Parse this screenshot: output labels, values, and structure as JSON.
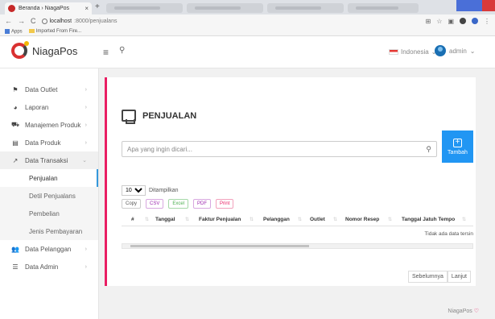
{
  "browser": {
    "tab_title": "Beranda › NiagaPos",
    "url_host": "localhost",
    "url_path": ":8000/penjualans",
    "bookmarks": [
      "Apps",
      "Imported From Fire..."
    ]
  },
  "header": {
    "brand": "NiagaPos",
    "language": "Indonesia",
    "user": "admin"
  },
  "sidebar": {
    "items": [
      {
        "label": "Data Outlet",
        "icon": "flag-icon"
      },
      {
        "label": "Laporan",
        "icon": "pie-chart-icon"
      },
      {
        "label": "Manajemen Produk",
        "icon": "cart-icon"
      },
      {
        "label": "Data Produk",
        "icon": "box-icon"
      },
      {
        "label": "Data Transaksi",
        "icon": "line-chart-icon",
        "open": true
      }
    ],
    "sub_items": [
      "Penjualan",
      "Detil Penjualans",
      "Pembelian",
      "Jenis Pembayaran"
    ],
    "items_after": [
      {
        "label": "Data Pelanggan",
        "icon": "users-icon"
      },
      {
        "label": "Data Admin",
        "icon": "list-icon"
      }
    ]
  },
  "main": {
    "title": "PENJUALAN",
    "search_placeholder": "Apa yang ingin dicari...",
    "add_button": "Tambah",
    "length_value": "10",
    "length_label": "Ditampilkan",
    "export_buttons": [
      "Copy",
      "CSV",
      "Excel",
      "PDF",
      "Print"
    ],
    "columns": [
      "#",
      "Tanggal",
      "Faktur Penjualan",
      "Pelanggan",
      "Outlet",
      "Nomor Resep",
      "Tanggal Jatuh Tempo"
    ],
    "empty_message": "Tidak ada data tersin",
    "pager": [
      "Sebelumnya",
      "Lanjut"
    ]
  },
  "footer": {
    "brand": "NiagaPos"
  },
  "colors": {
    "accent": "#e91e63",
    "primary": "#2196f3",
    "brand_red": "#d93131"
  }
}
